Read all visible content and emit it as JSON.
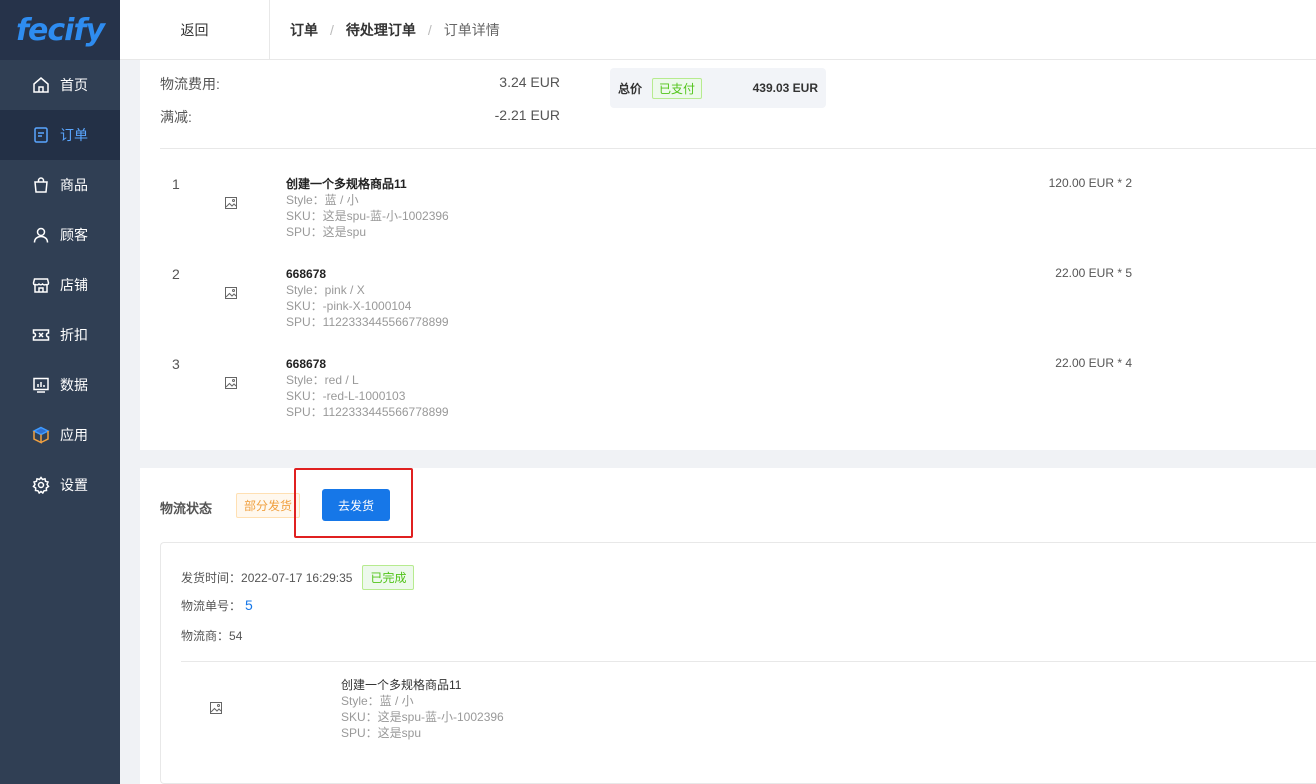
{
  "app": {
    "logo": "fecify"
  },
  "sidebar": {
    "items": [
      {
        "label": "首页",
        "icon": "home-icon",
        "active": false
      },
      {
        "label": "订单",
        "icon": "order-icon",
        "active": true
      },
      {
        "label": "商品",
        "icon": "bag-icon",
        "active": false
      },
      {
        "label": "顾客",
        "icon": "user-icon",
        "active": false
      },
      {
        "label": "店铺",
        "icon": "store-icon",
        "active": false
      },
      {
        "label": "折扣",
        "icon": "ticket-icon",
        "active": false
      },
      {
        "label": "数据",
        "icon": "chart-icon",
        "active": false
      },
      {
        "label": "应用",
        "icon": "box-icon",
        "active": false
      },
      {
        "label": "设置",
        "icon": "gear-icon",
        "active": false
      }
    ]
  },
  "header": {
    "back": "返回",
    "breadcrumb": [
      "订单",
      "待处理订单",
      "订单详情"
    ],
    "sep": "/"
  },
  "fees": {
    "shipping_label": "物流费用:",
    "shipping_value": "3.24 EUR",
    "discount_label": "满减:",
    "discount_value": "-2.21 EUR"
  },
  "total": {
    "label": "总价",
    "status": "已支付",
    "value": "439.03 EUR"
  },
  "products": [
    {
      "index": "1",
      "name": "创建一个多规格商品11",
      "style": "Style：蓝 / 小",
      "sku": "SKU：这是spu-蓝-小-1002396",
      "spu": "SPU：这是spu",
      "price": "120.00 EUR * 2"
    },
    {
      "index": "2",
      "name": "668678",
      "style": "Style：pink / X",
      "sku": "SKU：-pink-X-1000104",
      "spu": "SPU：1122333445566778899",
      "price": "22.00 EUR * 5"
    },
    {
      "index": "3",
      "name": "668678",
      "style": "Style：red / L",
      "sku": "SKU：-red-L-1000103",
      "spu": "SPU：1122333445566778899",
      "price": "22.00 EUR * 4"
    }
  ],
  "shipping": {
    "title": "物流状态",
    "status": "部分发货",
    "ship_button": "去发货",
    "shipment": {
      "time_label": "发货时间：",
      "time": "2022-07-17 16:29:35",
      "status": "已完成",
      "tracking_label": "物流单号：",
      "tracking": "5",
      "carrier_label": "物流商：",
      "carrier": "54",
      "product": {
        "name": "创建一个多规格商品11",
        "style": "Style：蓝 / 小",
        "sku": "SKU：这是spu-蓝-小-1002396",
        "spu": "SPU：这是spu"
      }
    }
  },
  "colors": {
    "sidebar": "#303f54",
    "accent": "#1677e8",
    "highlight": "#e02020"
  }
}
